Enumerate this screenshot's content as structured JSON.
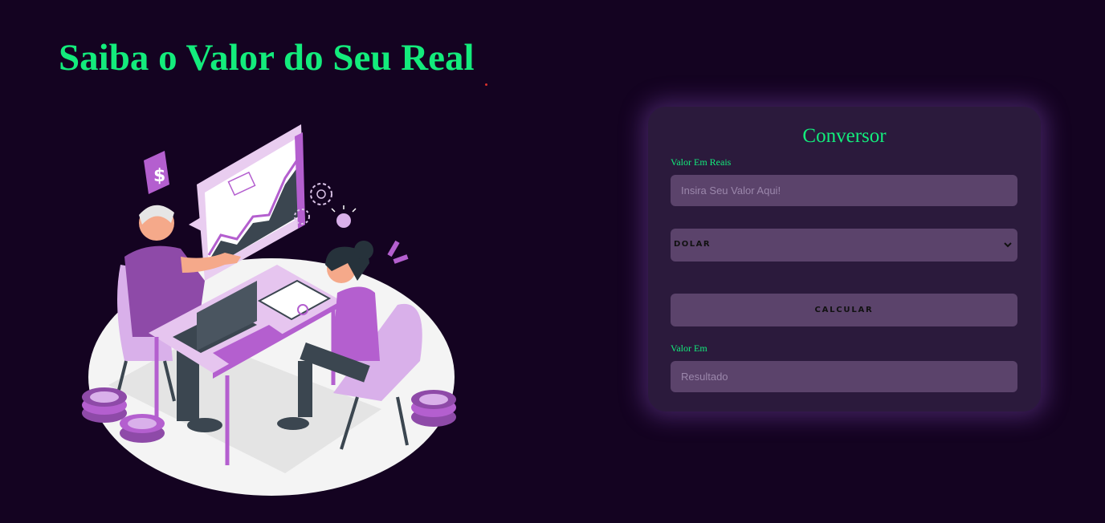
{
  "page": {
    "title": "Saiba o Valor do Seu Real"
  },
  "illustration": {
    "name": "meeting-illustration"
  },
  "converter": {
    "title": "Conversor",
    "input_label": "Valor Em Reais",
    "input_placeholder": "Insira Seu Valor Aqui!",
    "input_value": "",
    "currency_selected": "DOLAR",
    "calculate_label": "CALCULAR",
    "result_label": "Valor Em",
    "result_placeholder": "Resultado",
    "result_value": ""
  },
  "colors": {
    "background": "#140321",
    "accent_green": "#13ec7c",
    "card": "#2b1a3c",
    "field": "#5b436b",
    "purple": "#b45fcf"
  }
}
